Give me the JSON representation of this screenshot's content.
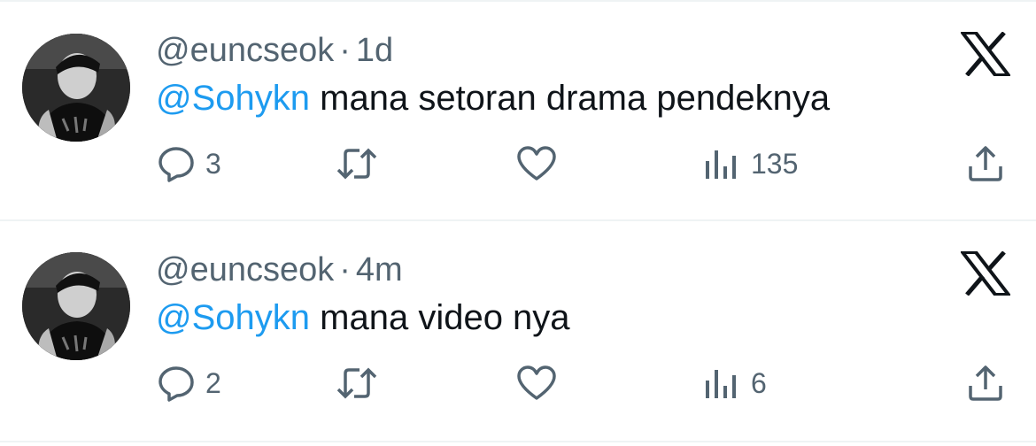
{
  "tweets": [
    {
      "handle": "@euncseok",
      "separator": "·",
      "time": "1d",
      "mention": "@Sohykn",
      "text": " mana setoran drama pendeknya",
      "reply_count": "3",
      "views_count": "135",
      "platform_icon": "x-logo-icon"
    },
    {
      "handle": "@euncseok",
      "separator": "·",
      "time": "4m",
      "mention": "@Sohykn",
      "text": " mana video nya",
      "reply_count": "2",
      "views_count": "6",
      "platform_icon": "x-logo-icon"
    }
  ],
  "colors": {
    "mention": "#1d9bf0",
    "secondary_text": "#536471",
    "primary_text": "#0f1419",
    "divider": "#eff3f4"
  }
}
